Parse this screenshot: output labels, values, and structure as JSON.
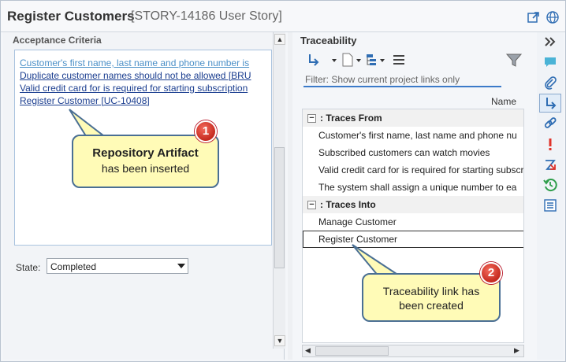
{
  "header": {
    "title": "Register Customers",
    "subtitle": "[STORY-14186 User Story]"
  },
  "left": {
    "section_title": "Acceptance Criteria",
    "criteria": [
      "Customer's first name, last name and phone number is",
      "Duplicate customer names should not be allowed [BRU",
      "Valid credit card for is required for starting subscription",
      "Register Customer [UC-10408]"
    ],
    "state_label": "State:",
    "state_value": "Completed"
  },
  "right": {
    "title": "Traceability",
    "filter_placeholder": "Filter:  Show current project links only",
    "column_name": "Name",
    "groups": [
      {
        "label": ": Traces From",
        "toggle": "−",
        "items": [
          "Customer's first name, last name and phone nu",
          "Subscribed customers can watch movies",
          "Valid credit card for is required for starting subscr",
          "The system shall assign a unique number to ea"
        ]
      },
      {
        "label": ": Traces Into",
        "toggle": "−",
        "items": [
          "Manage Customer",
          "Register Customer"
        ]
      }
    ]
  },
  "callouts": [
    {
      "badge": "1",
      "line1": "Repository Artifact",
      "line2": "has been inserted"
    },
    {
      "badge": "2",
      "line1": "Traceability link has",
      "line2": "been created"
    }
  ],
  "strip_icons": [
    "chevrons-right-icon",
    "comment-icon",
    "attachment-icon",
    "trace-link-icon",
    "link-icon",
    "exclamation-icon",
    "trace-arrow-icon",
    "history-icon",
    "list-icon"
  ],
  "colors": {
    "accent": "#3b7ac9",
    "link": "#1a3d8f",
    "callout_fill": "#fffbb7",
    "badge": "#d8342a"
  }
}
